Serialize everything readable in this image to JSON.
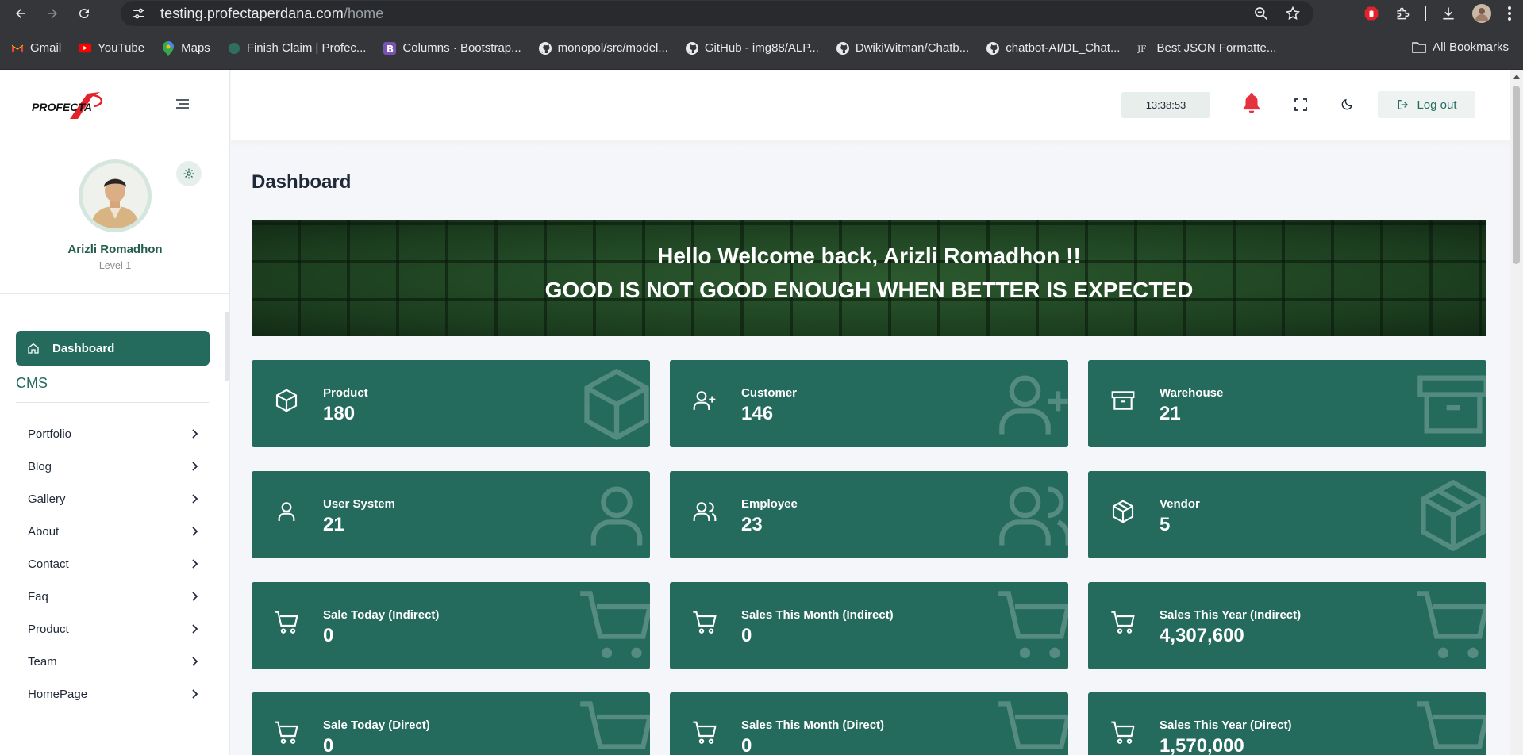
{
  "browser": {
    "url_host": "testing.profectaperdana.com",
    "url_path": "/home",
    "bookmarks": [
      {
        "label": "Gmail",
        "icon": "gmail-icon"
      },
      {
        "label": "YouTube",
        "icon": "youtube-icon"
      },
      {
        "label": "Maps",
        "icon": "maps-icon"
      },
      {
        "label": "Finish Claim | Profec...",
        "icon": "site-icon"
      },
      {
        "label": "Columns · Bootstrap...",
        "icon": "bootstrap-icon"
      },
      {
        "label": "monopol/src/model...",
        "icon": "github-icon"
      },
      {
        "label": "GitHub - img88/ALP...",
        "icon": "github-icon"
      },
      {
        "label": "DwikiWitman/Chatb...",
        "icon": "github-icon"
      },
      {
        "label": "chatbot-AI/DL_Chat...",
        "icon": "github-icon"
      },
      {
        "label": "Best JSON Formatte...",
        "icon": "jf-icon"
      }
    ],
    "all_bookmarks": "All Bookmarks"
  },
  "app": {
    "logo_text": "PROFECTA",
    "profile": {
      "name": "Arizli Romadhon",
      "level": "Level 1"
    },
    "nav_active": "Dashboard",
    "section_heading": "CMS",
    "nav_items": [
      "Portfolio",
      "Blog",
      "Gallery",
      "About",
      "Contact",
      "Faq",
      "Product",
      "Team",
      "HomePage"
    ],
    "clock": "13:38:53",
    "logout_label": "Log out",
    "page_title": "Dashboard",
    "banner": {
      "line1": "Hello Welcome back, Arizli Romadhon !!",
      "line2": "GOOD IS NOT GOOD ENOUGH WHEN BETTER IS EXPECTED"
    },
    "cards": [
      {
        "label": "Product",
        "value": "180",
        "icon": "box-icon"
      },
      {
        "label": "Customer",
        "value": "146",
        "icon": "user-plus-icon"
      },
      {
        "label": "Warehouse",
        "value": "21",
        "icon": "archive-icon"
      },
      {
        "label": "User System",
        "value": "21",
        "icon": "user-icon"
      },
      {
        "label": "Employee",
        "value": "23",
        "icon": "users-icon"
      },
      {
        "label": "Vendor",
        "value": "5",
        "icon": "package-icon"
      },
      {
        "label": "Sale Today (Indirect)",
        "value": "0",
        "icon": "cart-icon"
      },
      {
        "label": "Sales This Month (Indirect)",
        "value": "0",
        "icon": "cart-icon"
      },
      {
        "label": "Sales This Year (Indirect)",
        "value": "4,307,600",
        "icon": "cart-icon"
      },
      {
        "label": "Sale Today (Direct)",
        "value": "0",
        "icon": "cart-icon"
      },
      {
        "label": "Sales This Month (Direct)",
        "value": "0",
        "icon": "cart-icon"
      },
      {
        "label": "Sales This Year (Direct)",
        "value": "1,570,000",
        "icon": "cart-icon"
      }
    ]
  },
  "colors": {
    "primary": "#256b5d",
    "chrome_bg": "#35363a",
    "omnibox_bg": "#282a2d",
    "bell": "#e5323e",
    "logo_red": "#e5212a"
  }
}
